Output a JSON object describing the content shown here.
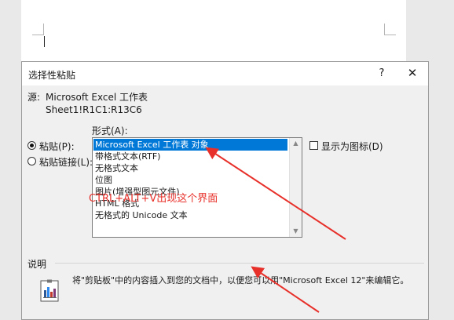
{
  "dialog": {
    "title": "选择性粘贴",
    "help": "?",
    "close": "✕",
    "source_label": "源:",
    "source_value": "Microsoft Excel 工作表",
    "source_range": "Sheet1!R1C1:R13C6",
    "format_label": "形式(A):",
    "options": {
      "paste": "粘贴(P):",
      "paste_link": "粘贴链接(L):",
      "selected": "paste"
    },
    "formats": [
      "Microsoft Excel 工作表 对象",
      "带格式文本(RTF)",
      "无格式文本",
      "位图",
      "图片(增强型图元文件)",
      "HTML 格式",
      "无格式的 Unicode 文本"
    ],
    "selected_format_index": 0,
    "display_as_icon": "显示为图标(D)",
    "display_as_icon_checked": false,
    "description_label": "说明",
    "description_text": "将\"剪贴板\"中的内容插入到您的文档中，以便您可以用\"Microsoft Excel 12\"来编辑它。"
  },
  "annotation": {
    "text": "CTRL+ALT+V出现这个界面",
    "color": "#e8302a"
  },
  "colors": {
    "selection": "#0078d7",
    "dialog_bg": "#f0f0f0"
  },
  "icons": {
    "paste_object": "chart-object-icon",
    "scroll_up": "chevron-up-icon",
    "scroll_down": "chevron-down-icon"
  }
}
